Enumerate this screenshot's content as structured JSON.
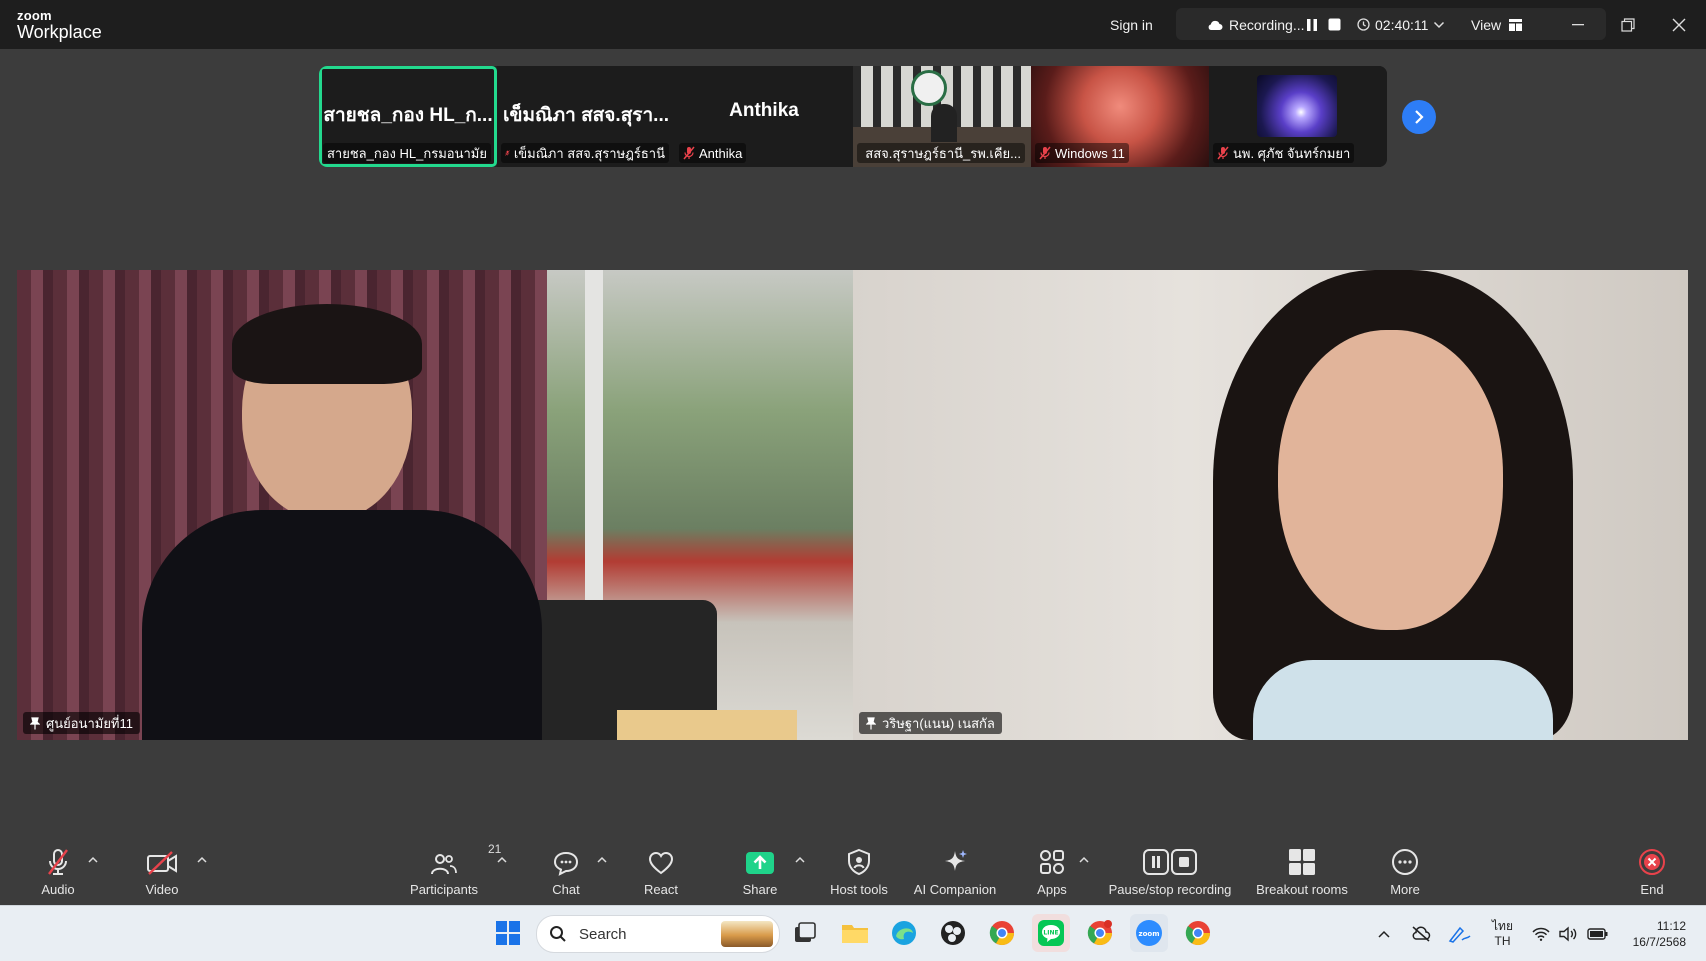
{
  "app": {
    "brand_small": "zoom",
    "brand_large": "Workplace"
  },
  "titlebar": {
    "sign_in": "Sign in",
    "recording_label": "Recording...",
    "timer": "02:40:11",
    "view_label": "View"
  },
  "thumbnails": [
    {
      "display_name": "สายชล_กอง HL_ก...",
      "caption": "สายชล_กอง HL_กรมอนามัย",
      "muted": false,
      "active": true
    },
    {
      "display_name": "เข็มณิภา สสจ.สุรา...",
      "caption": "เข็มณิภา สสจ.สุราษฎร์ธานี",
      "muted": true,
      "active": false
    },
    {
      "display_name": "Anthika",
      "caption": "Anthika",
      "muted": true,
      "active": false
    },
    {
      "display_name": "",
      "caption": "สสจ.สุราษฎร์ธานี_รพ.เคีย...",
      "muted": true,
      "active": false
    },
    {
      "display_name": "",
      "caption": "Windows 11",
      "muted": true,
      "active": false
    },
    {
      "display_name": "",
      "caption": "นพ. ศุภัช จันทร์กมยา",
      "muted": true,
      "active": false
    }
  ],
  "videos": [
    {
      "name": "ศูนย์อนามัยที่11"
    },
    {
      "name": "วริษฐา(แนน) เนสกัล"
    }
  ],
  "toolbar": {
    "audio": "Audio",
    "video": "Video",
    "participants": "Participants",
    "participants_count": "21",
    "chat": "Chat",
    "react": "React",
    "share": "Share",
    "host_tools": "Host tools",
    "ai_companion": "AI Companion",
    "apps": "Apps",
    "pause_stop": "Pause/stop recording",
    "breakout": "Breakout rooms",
    "more": "More",
    "end": "End"
  },
  "taskbar": {
    "search_placeholder": "Search",
    "lang_top": "ไทย",
    "lang_bottom": "TH",
    "time": "11:12",
    "date": "16/7/2568"
  },
  "colors": {
    "active_speaker": "#23d98e",
    "share_green": "#1fd38a",
    "next_blue": "#2d7df6",
    "muted_red": "#e8424b",
    "end_red": "#e8424b"
  }
}
